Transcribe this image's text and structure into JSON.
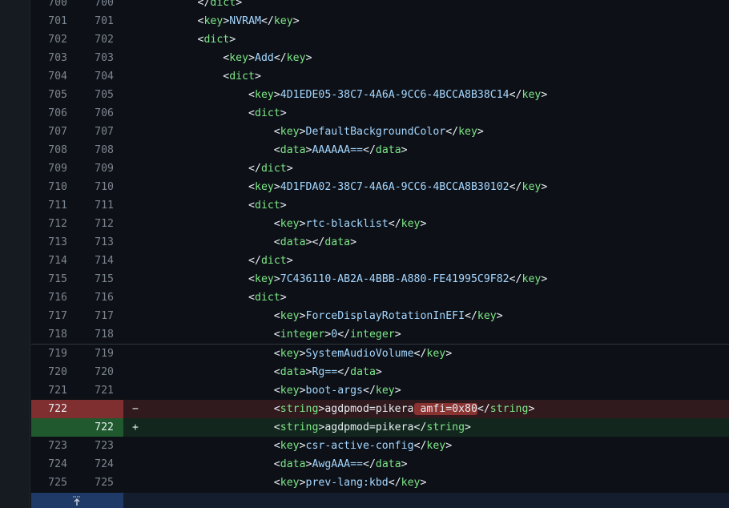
{
  "diff": {
    "rows": [
      {
        "type": "ctx",
        "old": "700",
        "new": "700",
        "sign": "",
        "segs": [
          [
            "ws",
            "        "
          ],
          [
            "punc",
            "</"
          ],
          [
            "tag",
            "dict"
          ],
          [
            "punc",
            ">"
          ]
        ]
      },
      {
        "type": "ctx",
        "old": "701",
        "new": "701",
        "sign": "",
        "segs": [
          [
            "ws",
            "        "
          ],
          [
            "punc",
            "<"
          ],
          [
            "tag",
            "key"
          ],
          [
            "punc",
            ">"
          ],
          [
            "val",
            "NVRAM"
          ],
          [
            "punc",
            "</"
          ],
          [
            "tag",
            "key"
          ],
          [
            "punc",
            ">"
          ]
        ]
      },
      {
        "type": "ctx",
        "old": "702",
        "new": "702",
        "sign": "",
        "segs": [
          [
            "ws",
            "        "
          ],
          [
            "punc",
            "<"
          ],
          [
            "tag",
            "dict"
          ],
          [
            "punc",
            ">"
          ]
        ]
      },
      {
        "type": "ctx",
        "old": "703",
        "new": "703",
        "sign": "",
        "segs": [
          [
            "ws",
            "            "
          ],
          [
            "punc",
            "<"
          ],
          [
            "tag",
            "key"
          ],
          [
            "punc",
            ">"
          ],
          [
            "val",
            "Add"
          ],
          [
            "punc",
            "</"
          ],
          [
            "tag",
            "key"
          ],
          [
            "punc",
            ">"
          ]
        ]
      },
      {
        "type": "ctx",
        "old": "704",
        "new": "704",
        "sign": "",
        "segs": [
          [
            "ws",
            "            "
          ],
          [
            "punc",
            "<"
          ],
          [
            "tag",
            "dict"
          ],
          [
            "punc",
            ">"
          ]
        ]
      },
      {
        "type": "ctx",
        "old": "705",
        "new": "705",
        "sign": "",
        "segs": [
          [
            "ws",
            "                "
          ],
          [
            "punc",
            "<"
          ],
          [
            "tag",
            "key"
          ],
          [
            "punc",
            ">"
          ],
          [
            "val",
            "4D1EDE05-38C7-4A6A-9CC6-4BCCA8B38C14"
          ],
          [
            "punc",
            "</"
          ],
          [
            "tag",
            "key"
          ],
          [
            "punc",
            ">"
          ]
        ]
      },
      {
        "type": "ctx",
        "old": "706",
        "new": "706",
        "sign": "",
        "segs": [
          [
            "ws",
            "                "
          ],
          [
            "punc",
            "<"
          ],
          [
            "tag",
            "dict"
          ],
          [
            "punc",
            ">"
          ]
        ]
      },
      {
        "type": "ctx",
        "old": "707",
        "new": "707",
        "sign": "",
        "segs": [
          [
            "ws",
            "                    "
          ],
          [
            "punc",
            "<"
          ],
          [
            "tag",
            "key"
          ],
          [
            "punc",
            ">"
          ],
          [
            "val",
            "DefaultBackgroundColor"
          ],
          [
            "punc",
            "</"
          ],
          [
            "tag",
            "key"
          ],
          [
            "punc",
            ">"
          ]
        ]
      },
      {
        "type": "ctx",
        "old": "708",
        "new": "708",
        "sign": "",
        "segs": [
          [
            "ws",
            "                    "
          ],
          [
            "punc",
            "<"
          ],
          [
            "tag",
            "data"
          ],
          [
            "punc",
            ">"
          ],
          [
            "val",
            "AAAAAA=="
          ],
          [
            "punc",
            "</"
          ],
          [
            "tag",
            "data"
          ],
          [
            "punc",
            ">"
          ]
        ]
      },
      {
        "type": "ctx",
        "old": "709",
        "new": "709",
        "sign": "",
        "segs": [
          [
            "ws",
            "                "
          ],
          [
            "punc",
            "</"
          ],
          [
            "tag",
            "dict"
          ],
          [
            "punc",
            ">"
          ]
        ]
      },
      {
        "type": "ctx",
        "old": "710",
        "new": "710",
        "sign": "",
        "segs": [
          [
            "ws",
            "                "
          ],
          [
            "punc",
            "<"
          ],
          [
            "tag",
            "key"
          ],
          [
            "punc",
            ">"
          ],
          [
            "val",
            "4D1FDA02-38C7-4A6A-9CC6-4BCCA8B30102"
          ],
          [
            "punc",
            "</"
          ],
          [
            "tag",
            "key"
          ],
          [
            "punc",
            ">"
          ]
        ]
      },
      {
        "type": "ctx",
        "old": "711",
        "new": "711",
        "sign": "",
        "segs": [
          [
            "ws",
            "                "
          ],
          [
            "punc",
            "<"
          ],
          [
            "tag",
            "dict"
          ],
          [
            "punc",
            ">"
          ]
        ]
      },
      {
        "type": "ctx",
        "old": "712",
        "new": "712",
        "sign": "",
        "segs": [
          [
            "ws",
            "                    "
          ],
          [
            "punc",
            "<"
          ],
          [
            "tag",
            "key"
          ],
          [
            "punc",
            ">"
          ],
          [
            "val",
            "rtc-blacklist"
          ],
          [
            "punc",
            "</"
          ],
          [
            "tag",
            "key"
          ],
          [
            "punc",
            ">"
          ]
        ]
      },
      {
        "type": "ctx",
        "old": "713",
        "new": "713",
        "sign": "",
        "segs": [
          [
            "ws",
            "                    "
          ],
          [
            "punc",
            "<"
          ],
          [
            "tag",
            "data"
          ],
          [
            "punc",
            "></"
          ],
          [
            "tag",
            "data"
          ],
          [
            "punc",
            ">"
          ]
        ]
      },
      {
        "type": "ctx",
        "old": "714",
        "new": "714",
        "sign": "",
        "segs": [
          [
            "ws",
            "                "
          ],
          [
            "punc",
            "</"
          ],
          [
            "tag",
            "dict"
          ],
          [
            "punc",
            ">"
          ]
        ]
      },
      {
        "type": "ctx",
        "old": "715",
        "new": "715",
        "sign": "",
        "segs": [
          [
            "ws",
            "                "
          ],
          [
            "punc",
            "<"
          ],
          [
            "tag",
            "key"
          ],
          [
            "punc",
            ">"
          ],
          [
            "val",
            "7C436110-AB2A-4BBB-A880-FE41995C9F82"
          ],
          [
            "punc",
            "</"
          ],
          [
            "tag",
            "key"
          ],
          [
            "punc",
            ">"
          ]
        ]
      },
      {
        "type": "ctx",
        "old": "716",
        "new": "716",
        "sign": "",
        "segs": [
          [
            "ws",
            "                "
          ],
          [
            "punc",
            "<"
          ],
          [
            "tag",
            "dict"
          ],
          [
            "punc",
            ">"
          ]
        ]
      },
      {
        "type": "ctx",
        "old": "717",
        "new": "717",
        "sign": "",
        "segs": [
          [
            "ws",
            "                    "
          ],
          [
            "punc",
            "<"
          ],
          [
            "tag",
            "key"
          ],
          [
            "punc",
            ">"
          ],
          [
            "val",
            "ForceDisplayRotationInEFI"
          ],
          [
            "punc",
            "</"
          ],
          [
            "tag",
            "key"
          ],
          [
            "punc",
            ">"
          ]
        ]
      },
      {
        "type": "ctx",
        "old": "718",
        "new": "718",
        "sign": "",
        "segs": [
          [
            "ws",
            "                    "
          ],
          [
            "punc",
            "<"
          ],
          [
            "tag",
            "integer"
          ],
          [
            "punc",
            ">"
          ],
          [
            "val",
            "0"
          ],
          [
            "punc",
            "</"
          ],
          [
            "tag",
            "integer"
          ],
          [
            "punc",
            ">"
          ]
        ]
      },
      {
        "type": "ctx",
        "old": "719",
        "new": "719",
        "sign": "",
        "sep": true,
        "segs": [
          [
            "ws",
            "                    "
          ],
          [
            "punc",
            "<"
          ],
          [
            "tag",
            "key"
          ],
          [
            "punc",
            ">"
          ],
          [
            "val",
            "SystemAudioVolume"
          ],
          [
            "punc",
            "</"
          ],
          [
            "tag",
            "key"
          ],
          [
            "punc",
            ">"
          ]
        ]
      },
      {
        "type": "ctx",
        "old": "720",
        "new": "720",
        "sign": "",
        "segs": [
          [
            "ws",
            "                    "
          ],
          [
            "punc",
            "<"
          ],
          [
            "tag",
            "data"
          ],
          [
            "punc",
            ">"
          ],
          [
            "val",
            "Rg=="
          ],
          [
            "punc",
            "</"
          ],
          [
            "tag",
            "data"
          ],
          [
            "punc",
            ">"
          ]
        ]
      },
      {
        "type": "ctx",
        "old": "721",
        "new": "721",
        "sign": "",
        "segs": [
          [
            "ws",
            "                    "
          ],
          [
            "punc",
            "<"
          ],
          [
            "tag",
            "key"
          ],
          [
            "punc",
            ">"
          ],
          [
            "val",
            "boot-args"
          ],
          [
            "punc",
            "</"
          ],
          [
            "tag",
            "key"
          ],
          [
            "punc",
            ">"
          ]
        ]
      },
      {
        "type": "del",
        "old": "722",
        "new": "",
        "sign": "−",
        "segs": [
          [
            "ws",
            "                    "
          ],
          [
            "punc",
            "<"
          ],
          [
            "tag",
            "string"
          ],
          [
            "punc",
            ">"
          ],
          [
            "punc",
            "agdpmod=pikera"
          ],
          [
            "hl",
            " amfi=0x80"
          ],
          [
            "punc",
            "</"
          ],
          [
            "tag",
            "string"
          ],
          [
            "punc",
            ">"
          ]
        ]
      },
      {
        "type": "add",
        "old": "",
        "new": "722",
        "sign": "+",
        "segs": [
          [
            "ws",
            "                    "
          ],
          [
            "punc",
            "<"
          ],
          [
            "tag",
            "string"
          ],
          [
            "punc",
            ">"
          ],
          [
            "punc",
            "agdpmod=pikera"
          ],
          [
            "punc",
            "</"
          ],
          [
            "tag",
            "string"
          ],
          [
            "punc",
            ">"
          ]
        ]
      },
      {
        "type": "ctx",
        "old": "723",
        "new": "723",
        "sign": "",
        "segs": [
          [
            "ws",
            "                    "
          ],
          [
            "punc",
            "<"
          ],
          [
            "tag",
            "key"
          ],
          [
            "punc",
            ">"
          ],
          [
            "val",
            "csr-active-config"
          ],
          [
            "punc",
            "</"
          ],
          [
            "tag",
            "key"
          ],
          [
            "punc",
            ">"
          ]
        ]
      },
      {
        "type": "ctx",
        "old": "724",
        "new": "724",
        "sign": "",
        "segs": [
          [
            "ws",
            "                    "
          ],
          [
            "punc",
            "<"
          ],
          [
            "tag",
            "data"
          ],
          [
            "punc",
            ">"
          ],
          [
            "val",
            "AwgAAA=="
          ],
          [
            "punc",
            "</"
          ],
          [
            "tag",
            "data"
          ],
          [
            "punc",
            ">"
          ]
        ]
      },
      {
        "type": "ctx",
        "old": "725",
        "new": "725",
        "sign": "",
        "segs": [
          [
            "ws",
            "                    "
          ],
          [
            "punc",
            "<"
          ],
          [
            "tag",
            "key"
          ],
          [
            "punc",
            ">"
          ],
          [
            "val",
            "prev-lang:kbd"
          ],
          [
            "punc",
            "</"
          ],
          [
            "tag",
            "key"
          ],
          [
            "punc",
            ">"
          ]
        ]
      }
    ]
  },
  "colors": {
    "background": "#0d1117",
    "tag": "#7ee787",
    "value": "#a5d6ff",
    "deletion": "#f85149",
    "addition": "#3fb950"
  },
  "expand": {
    "icon": "unfold-expand-icon"
  }
}
